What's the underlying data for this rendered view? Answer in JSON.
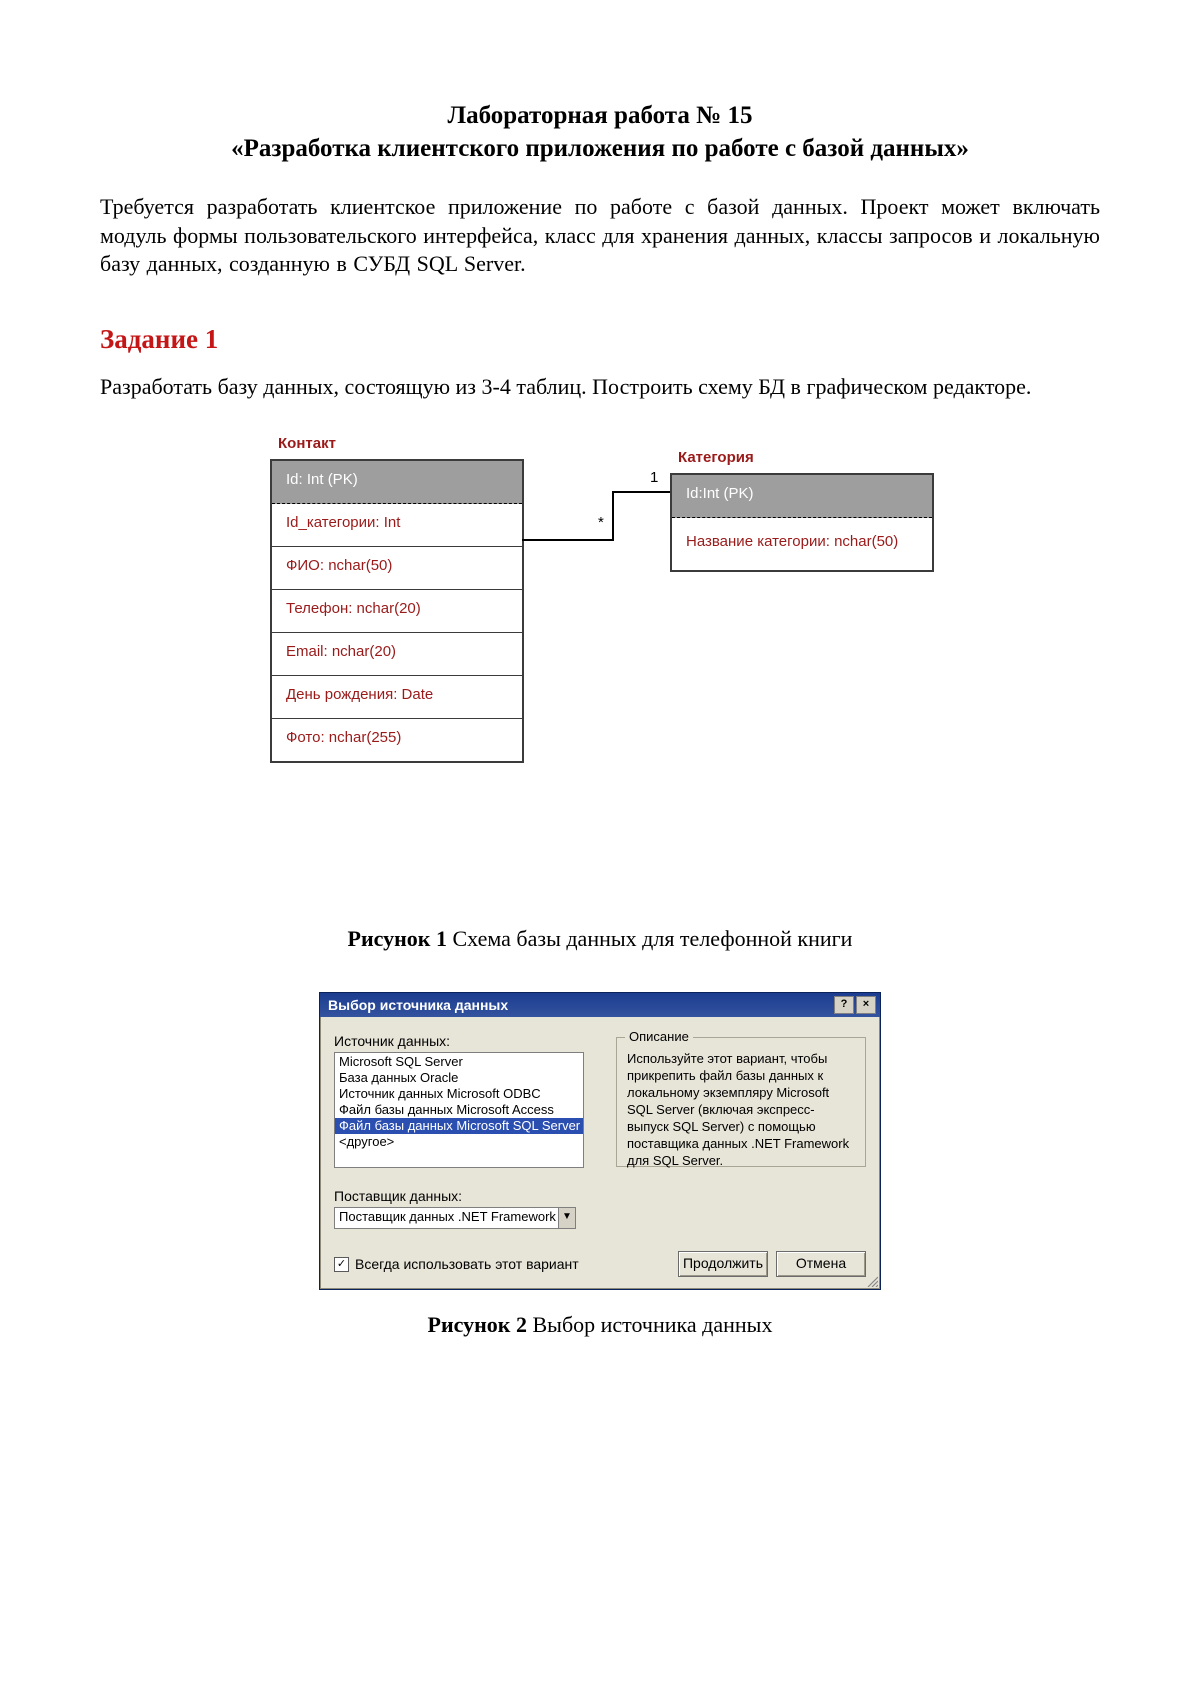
{
  "doc": {
    "title_line1": "Лабораторная работа № 15",
    "title_line2": "«Разработка клиентского приложения по работе с базой данных»",
    "intro": "Требуется разработать клиентское приложение по работе с базой данных. Проект может включать модуль формы пользовательского интерфейса, класс для хранения данных, классы запросов и локальную базу данных, созданную в СУБД SQL Server.",
    "task1_heading": "Задание 1",
    "task1_body": "Разработать базу данных, состоящую из 3-4 таблиц. Построить схему БД в графическом редакторе.",
    "fig1_bold": "Рисунок 1",
    "fig1_rest": " Схема базы данных для телефонной книги",
    "fig2_bold": "Рисунок 2",
    "fig2_rest": " Выбор источника данных"
  },
  "diagram": {
    "contact": {
      "title": "Контакт",
      "fields": [
        "Id: Int (PK)",
        "Id_категории: Int",
        "ФИО: nchar(50)",
        "Телефон: nchar(20)",
        "Email: nchar(20)",
        "День рождения: Date",
        "Фото: nchar(255)"
      ]
    },
    "category": {
      "title": "Категория",
      "fields": [
        "Id:Int (PK)",
        "Название категории: nchar(50)"
      ]
    },
    "relation": {
      "many": "*",
      "one": "1"
    }
  },
  "dialog": {
    "title": "Выбор источника данных",
    "help_btn": "?",
    "close_btn": "×",
    "data_source_label": "Источник данных:",
    "data_sources": [
      "Microsoft SQL Server",
      "База данных Oracle",
      "Источник данных Microsoft ODBC",
      "Файл базы данных Microsoft Access",
      "Файл базы данных Microsoft SQL Server",
      "<другое>"
    ],
    "data_source_selected_index": 4,
    "description_legend": "Описание",
    "description_text": "Используйте этот вариант, чтобы прикрепить файл базы данных к локальному экземпляру Microsoft SQL Server (включая экспресс-выпуск SQL Server) с помощью поставщика данных .NET Framework для SQL Server.",
    "provider_label": "Поставщик данных:",
    "provider_value": "Поставщик данных .NET Framework д",
    "always_use_label": "Всегда использовать этот вариант",
    "always_use_checked": true,
    "continue_btn": "Продолжить",
    "cancel_btn": "Отмена"
  }
}
